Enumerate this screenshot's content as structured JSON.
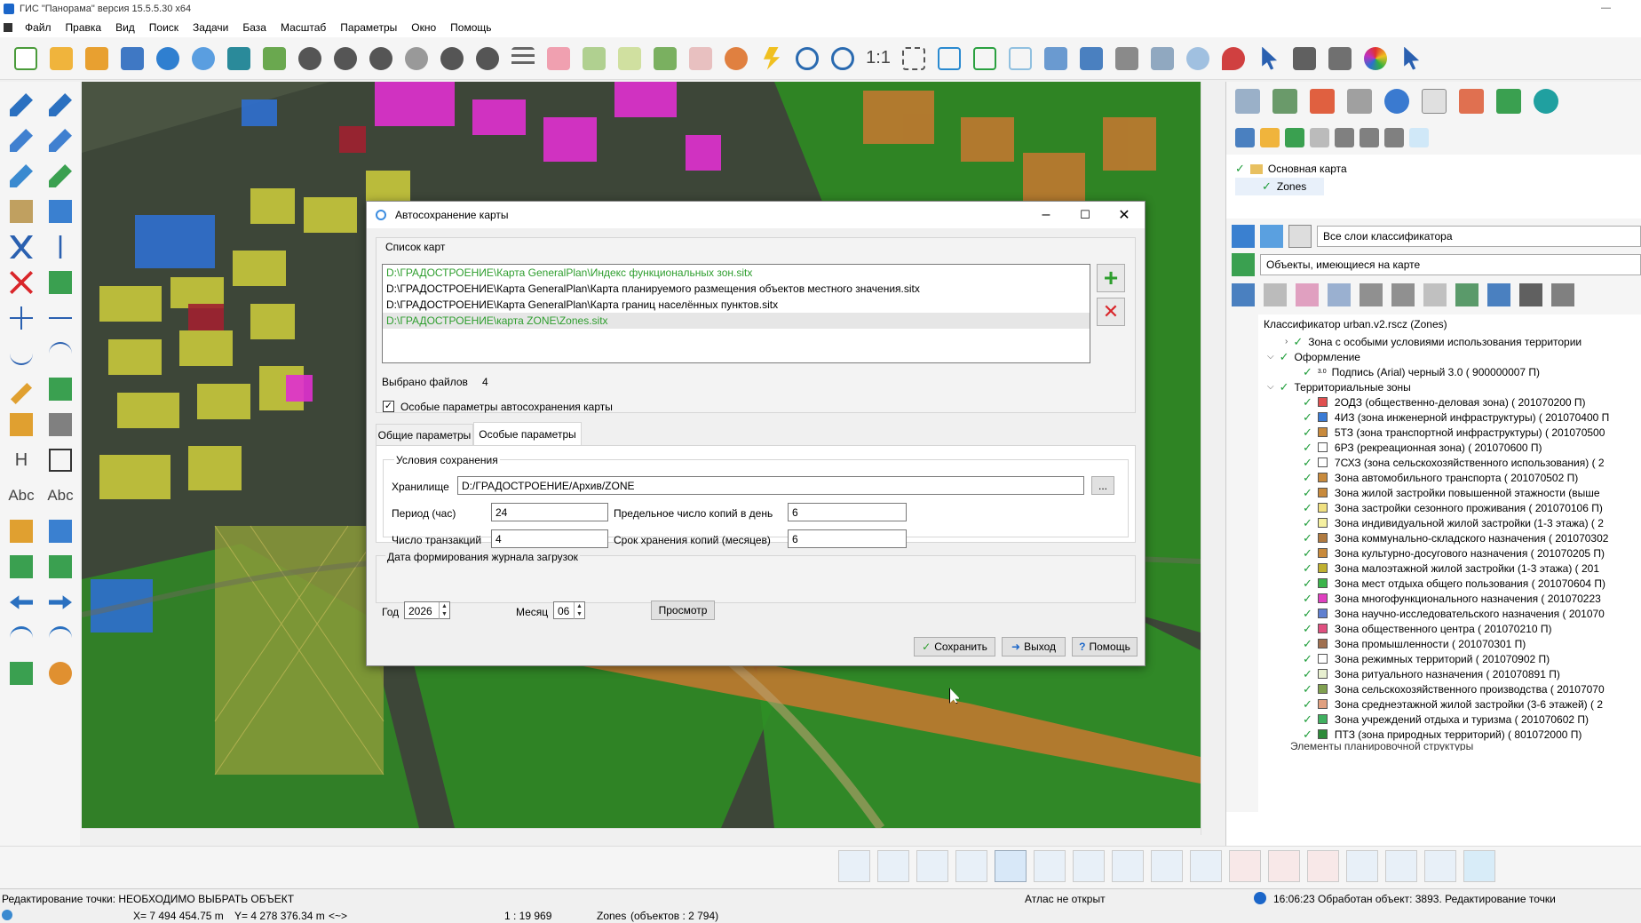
{
  "window": {
    "title": "ГИС \"Панорама\" версия 15.5.5.30 x64"
  },
  "menu": [
    "Файл",
    "Правка",
    "Вид",
    "Поиск",
    "Задачи",
    "База",
    "Масштаб",
    "Параметры",
    "Окно",
    "Помощь"
  ],
  "toolbar": {
    "zoom_label": "1:1"
  },
  "left_tools": {
    "h": "H",
    "abc1": "Abc",
    "abc2": "Abc"
  },
  "right_panel": {
    "tree": {
      "root": "Основная карта",
      "child": "Zones"
    },
    "filter1": "Все слои классификатора",
    "filter2": "Объекты, имеющиеся на карте",
    "classifier_title": "Классификатор urban.v2.rscz (Zones)",
    "items": [
      {
        "text": "Зона с особыми условиями использования территории",
        "kind": "group-collapsed"
      },
      {
        "text": "Оформление",
        "kind": "group"
      },
      {
        "text": "Подпись (Arial) черный 3.0 ( 900000007 П)",
        "kind": "label",
        "prefix": "3.0"
      },
      {
        "text": "Территориальные зоны",
        "kind": "group"
      },
      {
        "text": "2ОДЗ (общественно-деловая зона) ( 201070200 П)",
        "color": "#e05050"
      },
      {
        "text": "4ИЗ (зона инженерной инфраструктуры) ( 201070400 П",
        "color": "#3a7bd5"
      },
      {
        "text": "5ТЗ (зона транспортной инфраструктуры) ( 201070500",
        "color": "#c88a3c"
      },
      {
        "text": "6РЗ (рекреационная зона) ( 201070600 П)",
        "color": "#ffffff"
      },
      {
        "text": "7СХЗ (зона сельскохозяйственного использования) ( 2",
        "color": "#ffffff"
      },
      {
        "text": "Зона автомобильного транспорта ( 201070502 П)",
        "color": "#c88a3c"
      },
      {
        "text": "Зона жилой застройки повышенной этажности (выше",
        "color": "#c88a3c"
      },
      {
        "text": "Зона застройки сезонного проживания ( 201070106 П)",
        "color": "#f0e080"
      },
      {
        "text": "Зона индивидуальной жилой застройки (1-3 этажа) ( 2",
        "color": "#f5f0a0"
      },
      {
        "text": "Зона коммунально-складского назначения ( 201070302",
        "color": "#b07a40"
      },
      {
        "text": "Зона культурно-досугового назначения ( 201070205 П)",
        "color": "#c88a3c"
      },
      {
        "text": "Зона малоэтажной жилой застройки (1-3 этажа) ( 201",
        "color": "#c0b030"
      },
      {
        "text": "Зона мест отдыха общего пользования ( 201070604 П)",
        "color": "#3cb44b"
      },
      {
        "text": "Зона многофункционального назначения ( 201070223",
        "color": "#e040c0"
      },
      {
        "text": "Зона научно-исследовательского назначения ( 201070",
        "color": "#6080d0"
      },
      {
        "text": "Зона общественного центра ( 201070210 П)",
        "color": "#e05080"
      },
      {
        "text": "Зона промышленности ( 201070301 П)",
        "color": "#a07050"
      },
      {
        "text": "Зона режимных территорий ( 201070902 П)",
        "color": "#ffffff"
      },
      {
        "text": "Зона ритуального назначения ( 201070891 П)",
        "color": "#e8f0d0"
      },
      {
        "text": "Зона сельскохозяйственного производства ( 20107070",
        "color": "#80a050"
      },
      {
        "text": "Зона среднеэтажной жилой застройки (3-6 этажей) ( 2",
        "color": "#e0a080"
      },
      {
        "text": "Зона учреждений отдыха и туризма ( 201070602 П)",
        "color": "#40b060"
      },
      {
        "text": "ПТЗ (зона природных территорий) ( 801072000 П)",
        "color": "#2e8b3a"
      }
    ],
    "cut_item": "Элементы планировочной структуры"
  },
  "status": {
    "edit_point": "Редактирование точки: НЕОБХОДИМО ВЫБРАТЬ ОБЪЕКТ",
    "atlas": "Атлас не открыт",
    "message": "16:06:23  Обработан объект: 3893. Редактирование точки",
    "x": "X= 7 494 454.75 m",
    "y": "Y= 4 278 376.34 m",
    "arrows": "<~>",
    "scale": "1 : 19 969",
    "layer": "Zones",
    "objects": "(объектов : 2 794)"
  },
  "dialog": {
    "title": "Автосохранение карты",
    "list_label": "Список карт",
    "files": [
      {
        "path": "D:\\ГРАДОСТРОЕНИЕ\\Карта GeneralPlan\\Индекс функциональных зон.sitx",
        "color": "#2e9e2e"
      },
      {
        "path": "D:\\ГРАДОСТРОЕНИЕ\\Карта GeneralPlan\\Карта планируемого размещения объектов местного значения.sitx",
        "color": "#000000"
      },
      {
        "path": "D:\\ГРАДОСТРОЕНИЕ\\Карта GeneralPlan\\Карта границ населённых пунктов.sitx",
        "color": "#000000"
      },
      {
        "path": "D:\\ГРАДОСТРОЕНИЕ\\карта ZONE\\Zones.sitx",
        "color": "#2e9e2e"
      }
    ],
    "selected_label": "Выбрано файлов",
    "selected_count": "4",
    "special_check": "Особые параметры автосохранения карты",
    "tabs": [
      "Общие параметры",
      "Особые параметры"
    ],
    "conditions_label": "Условия сохранения",
    "storage_label": "Хранилище",
    "storage_value": "D:/ГРАДОСТРОЕНИЕ/Архив/ZONE",
    "browse": "...",
    "period_label": "Период (час)",
    "period_value": "24",
    "max_copies_label": "Предельное число копий в день",
    "max_copies_value": "6",
    "transactions_label": "Число транзакций",
    "transactions_value": "4",
    "retention_label": "Срок хранения копий (месяцев)",
    "retention_value": "6",
    "journal_label": "Дата формирования журнала загрузок",
    "year_label": "Год",
    "year_value": "2026",
    "month_label": "Месяц",
    "month_value": "06",
    "view_button": "Просмотр",
    "save_button": "Сохранить",
    "exit_button": "Выход",
    "help_button": "Помощь"
  },
  "colors": {
    "accent": "#1b66c9",
    "green": "#2e9e2e",
    "red": "#d9262a"
  }
}
